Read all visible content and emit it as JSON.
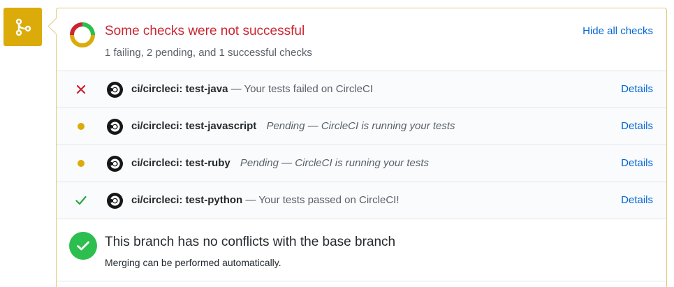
{
  "summary": {
    "title": "Some checks were not successful",
    "subtitle": "1 failing, 2 pending, and 1 successful checks",
    "hide_link": "Hide all checks",
    "donut_counts": {
      "failing": 1,
      "pending": 2,
      "successful": 1
    }
  },
  "checks": [
    {
      "status": "failure",
      "name": "ci/circleci: test-java",
      "description": "— Your tests failed on CircleCI",
      "italic": false,
      "details": "Details"
    },
    {
      "status": "pending",
      "name": "ci/circleci: test-javascript",
      "description": "Pending — CircleCI is running your tests",
      "italic": true,
      "details": "Details"
    },
    {
      "status": "pending",
      "name": "ci/circleci: test-ruby",
      "description": "Pending — CircleCI is running your tests",
      "italic": true,
      "details": "Details"
    },
    {
      "status": "success",
      "name": "ci/circleci: test-python",
      "description": "— Your tests passed on CircleCI!",
      "italic": false,
      "details": "Details"
    }
  ],
  "merge": {
    "title": "This branch has no conflicts with the base branch",
    "subtitle": "Merging can be performed automatically."
  },
  "colors": {
    "failure": "#cb2431",
    "pending": "#dbab09",
    "success": "#2cbe4e",
    "link": "#0366d6"
  },
  "icons": {
    "merge": "git-merge-icon",
    "failure": "x-icon",
    "pending": "dot-icon",
    "success": "check-icon",
    "ci": "circleci-logo-icon"
  }
}
